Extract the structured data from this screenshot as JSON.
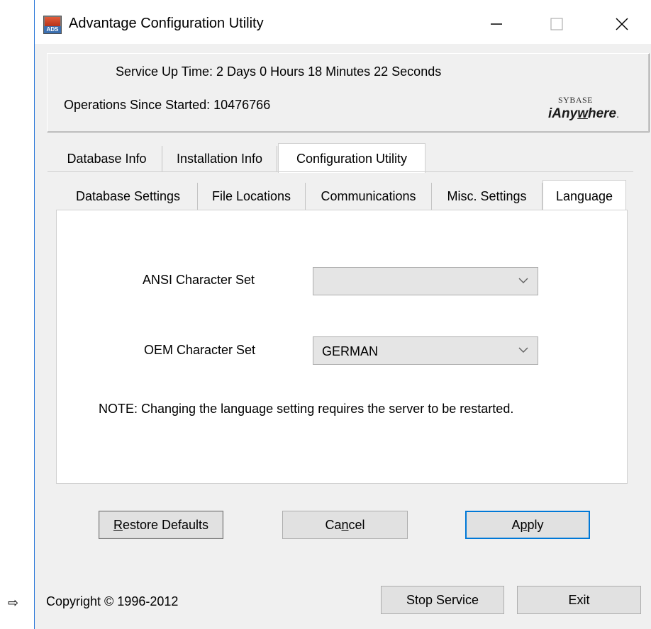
{
  "window": {
    "title": "Advantage Configuration Utility",
    "icon_text": "ADS",
    "controls": {
      "minimize": "—",
      "maximize": "☐",
      "close": "✕"
    }
  },
  "header": {
    "service_up_time": "Service Up Time: 2 Days 0 Hours 18 Minutes 22 Seconds",
    "operations": "Operations Since Started: 10476766",
    "logo_top": "SYBASE",
    "logo_prefix": "iAny",
    "logo_underlined": "w",
    "logo_suffix": "here",
    "logo_dot": "."
  },
  "outer_tabs": [
    {
      "label": "Database Info",
      "active": false
    },
    {
      "label": "Installation Info",
      "active": false
    },
    {
      "label": "Configuration Utility",
      "active": true
    }
  ],
  "inner_tabs": [
    {
      "label": "Database Settings",
      "active": false
    },
    {
      "label": "File Locations",
      "active": false
    },
    {
      "label": "Communications",
      "active": false
    },
    {
      "label": "Misc. Settings",
      "active": false
    },
    {
      "label": "Language",
      "active": true
    }
  ],
  "language": {
    "ansi_label": "ANSI Character Set",
    "ansi_value": "",
    "oem_label": "OEM Character Set",
    "oem_value": "GERMAN",
    "note": "NOTE: Changing the language setting requires the server to be restarted."
  },
  "buttons": {
    "restore_pre": "",
    "restore_ul": "R",
    "restore_post": "estore Defaults",
    "cancel_pre": "Ca",
    "cancel_ul": "n",
    "cancel_post": "cel",
    "apply_pre": "A",
    "apply_ul": "p",
    "apply_post": "ply",
    "stop_service": "Stop Service",
    "exit": "Exit"
  },
  "footer": {
    "copyright": "Copyright © 1996-2012",
    "arrow": "⇨"
  },
  "colors": {
    "accent": "#0078d7",
    "window_bg": "#f0f0f0",
    "border_blue": "#2b78d8"
  }
}
